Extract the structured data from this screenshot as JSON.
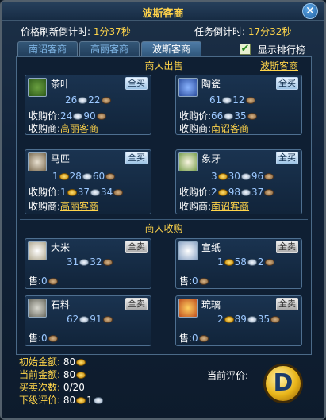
{
  "title": "波斯客商",
  "close_glyph": "✕",
  "timers": {
    "price_refresh_label": "价格刷新倒计时:",
    "price_refresh_value": "1分37秒",
    "task_label": "任务倒计时:",
    "task_value": "17分32秒"
  },
  "tabs": [
    {
      "label": "南诏客商"
    },
    {
      "label": "高丽客商"
    },
    {
      "label": "波斯客商",
      "active": true
    }
  ],
  "ranking": {
    "checked": true,
    "label": "显示排行榜",
    "check_glyph": "✔"
  },
  "sell_section": {
    "title": "商人出售",
    "merchant_link": "波斯客商",
    "items": [
      {
        "name": "茶叶",
        "btn": "全买",
        "price": {
          "silver": "26",
          "copper": "22"
        },
        "buy_label": "收购价:",
        "buy": {
          "silver": "24",
          "copper": "90"
        },
        "merchant_label": "收购商:",
        "merchant": "高丽客商",
        "icon": "tea-icon"
      },
      {
        "name": "陶瓷",
        "btn": "全买",
        "price": {
          "silver": "61",
          "copper": "12"
        },
        "buy_label": "收购价:",
        "buy": {
          "silver": "66",
          "copper": "35"
        },
        "merchant_label": "收购商:",
        "merchant": "南诏客商",
        "icon": "porcelain-icon"
      },
      {
        "name": "马匹",
        "btn": "全买",
        "price": {
          "gold": "1",
          "silver": "28",
          "copper": "60"
        },
        "buy_label": "收购价:",
        "buy": {
          "gold": "1",
          "silver": "37",
          "copper": "34"
        },
        "merchant_label": "收购商:",
        "merchant": "高丽客商",
        "icon": "horse-icon"
      },
      {
        "name": "象牙",
        "btn": "全买",
        "price": {
          "gold": "3",
          "silver": "30",
          "copper": "96"
        },
        "buy_label": "收购价:",
        "buy": {
          "gold": "2",
          "silver": "98",
          "copper": "37"
        },
        "merchant_label": "收购商:",
        "merchant": "南诏客商",
        "icon": "ivory-icon"
      }
    ]
  },
  "buy_section": {
    "title": "商人收购",
    "items": [
      {
        "name": "大米",
        "btn": "全卖",
        "price": {
          "silver": "31",
          "copper": "32"
        },
        "sell_label": "售:",
        "sell": "0",
        "icon": "rice-icon"
      },
      {
        "name": "宣纸",
        "btn": "全卖",
        "price": {
          "gold": "1",
          "silver": "58",
          "copper": "2"
        },
        "sell_label": "售:",
        "sell": "0",
        "icon": "paper-icon"
      },
      {
        "name": "石料",
        "btn": "全卖",
        "price": {
          "silver": "62",
          "copper": "91"
        },
        "sell_label": "售:",
        "sell": "0",
        "icon": "stone-icon"
      },
      {
        "name": "琉璃",
        "btn": "全卖",
        "price": {
          "gold": "2",
          "silver": "89",
          "copper": "35"
        },
        "sell_label": "售:",
        "sell": "0",
        "icon": "glass-icon"
      }
    ]
  },
  "bottom": {
    "initial_label": "初始金额:",
    "initial": "80",
    "current_label": "当前金额:",
    "current": "80",
    "trades_label": "买卖次数:",
    "trades": "0/20",
    "next_label": "下级评价:",
    "next_gold": "80",
    "next_silver": "1",
    "eval_label": "当前评价:",
    "grade": "D"
  },
  "colors": {
    "accent_yellow": "#ffd44a",
    "price_blue": "#9cc8ff",
    "panel_border": "#4e6f90"
  }
}
